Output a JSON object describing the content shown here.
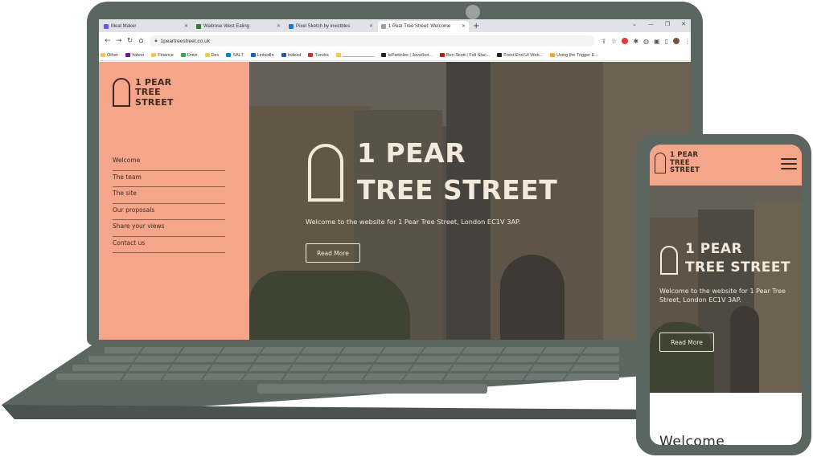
{
  "browser": {
    "tabs": [
      {
        "label": "Meal Maker",
        "color": "#7c4dff"
      },
      {
        "label": "Waitrose West Ealing",
        "color": "#2e7d32"
      },
      {
        "label": "Pixel Sketch by invictbles",
        "color": "#1976d2"
      },
      {
        "label": "1 Pear Tree Street: Welcome",
        "color": "#9e9e9e"
      }
    ],
    "url": "1peartreestreet.co.uk",
    "bookmarks": [
      {
        "label": "Other",
        "color": "#f2c94c"
      },
      {
        "label": "Yahoo",
        "color": "#6a1b9a"
      },
      {
        "label": "Finance",
        "color": "#f2c94c"
      },
      {
        "label": "Drive",
        "color": "#34a853"
      },
      {
        "label": "Dev",
        "color": "#f2c94c"
      },
      {
        "label": "SALT",
        "color": "#0288d1"
      },
      {
        "label": "LinkedIn",
        "color": "#0a66c2"
      },
      {
        "label": "Indeed",
        "color": "#2557a7"
      },
      {
        "label": "Tundra",
        "color": "#d32f2f"
      },
      {
        "label": "_____________",
        "color": "#f2c94c"
      },
      {
        "label": "tsParticles | JavaScri...",
        "color": "#222222"
      },
      {
        "label": "Ben Scott | Full Stac...",
        "color": "#b71c1c"
      },
      {
        "label": "Front-End UI Web...",
        "color": "#222222"
      },
      {
        "label": "Using the Trigger E...",
        "color": "#f9a825"
      }
    ]
  },
  "site": {
    "logo": {
      "line1": "1 PEAR",
      "line2": "TREE",
      "line3": "STREET"
    },
    "nav": [
      "Welcome",
      "The team",
      "The site",
      "Our proposals",
      "Share your views",
      "Contact us"
    ],
    "hero": {
      "title_line1": "1 PEAR",
      "title_line2": "TREE STREET",
      "subtitle": "Welcome to the website for 1 Pear Tree Street, London EC1V 3AP.",
      "button": "Read More"
    }
  },
  "mobile": {
    "logo": {
      "line1": "1 PEAR",
      "line2": "TREE",
      "line3": "STREET"
    },
    "hero": {
      "title_line1": "1 PEAR",
      "title_line2": "TREE STREET",
      "subtitle": "Welcome to the website for 1 Pear Tree Street, London EC1V 3AP.",
      "button": "Read More"
    },
    "section_heading": "Welcome"
  },
  "colors": {
    "accent": "#f5a68a",
    "text_dark": "#3e2a22",
    "hero_text": "#f4eadc",
    "device": "#5c6661"
  }
}
